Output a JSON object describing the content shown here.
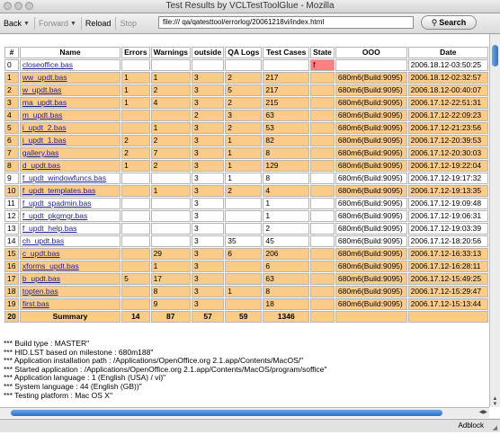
{
  "window": {
    "title": "Test Results by VCLTestToolGlue - Mozilla"
  },
  "toolbar": {
    "back_label": "Back",
    "forward_label": "Forward",
    "reload_label": "Reload",
    "stop_label": "Stop",
    "url": "file:///  qa/qatesttool/errorlog/20061218vi/index.html",
    "search_label": "Search"
  },
  "table": {
    "headers": [
      "#",
      "Name",
      "Errors",
      "Warnings",
      "outside",
      "QA Logs",
      "Test Cases",
      "State",
      "OOO",
      "Date"
    ],
    "rows": [
      {
        "n": "0",
        "name": "closeoffice.bas",
        "errors": "",
        "warnings": "",
        "outside": "",
        "qa": "",
        "tc": "",
        "state": "f",
        "ooo": "",
        "date": "2006.18.12-03:50:25",
        "hl": false,
        "red": true
      },
      {
        "n": "1",
        "name": "ww_updt.bas",
        "errors": "1",
        "warnings": "1",
        "outside": "3",
        "qa": "2",
        "tc": "217",
        "state": "",
        "ooo": "680m6(Build:9095)",
        "date": "2006.18.12-02:32:57",
        "hl": true,
        "red": false
      },
      {
        "n": "2",
        "name": "w_updt.bas",
        "errors": "1",
        "warnings": "2",
        "outside": "3",
        "qa": "5",
        "tc": "217",
        "state": "",
        "ooo": "680m6(Build:9095)",
        "date": "2006.18.12-00:40:07",
        "hl": true,
        "red": false
      },
      {
        "n": "3",
        "name": "ma_updt.bas",
        "errors": "1",
        "warnings": "4",
        "outside": "3",
        "qa": "2",
        "tc": "215",
        "state": "",
        "ooo": "680m6(Build:9095)",
        "date": "2006.17.12-22:51:31",
        "hl": true,
        "red": false
      },
      {
        "n": "4",
        "name": "m_updt.bas",
        "errors": "",
        "warnings": "",
        "outside": "2",
        "qa": "3",
        "tc": "63",
        "state": "",
        "ooo": "680m6(Build:9095)",
        "date": "2006.17.12-22:09:23",
        "hl": true,
        "red": false
      },
      {
        "n": "5",
        "name": "i_updt_2.bas",
        "errors": "",
        "warnings": "1",
        "outside": "3",
        "qa": "2",
        "tc": "53",
        "state": "",
        "ooo": "680m6(Build:9095)",
        "date": "2006.17.12-21:23:56",
        "hl": true,
        "red": false
      },
      {
        "n": "6",
        "name": "i_updt_1.bas",
        "errors": "2",
        "warnings": "2",
        "outside": "3",
        "qa": "1",
        "tc": "82",
        "state": "",
        "ooo": "680m6(Build:9095)",
        "date": "2006.17.12-20:39:53",
        "hl": true,
        "red": false
      },
      {
        "n": "7",
        "name": "gallery.bas",
        "errors": "2",
        "warnings": "7",
        "outside": "3",
        "qa": "1",
        "tc": "8",
        "state": "",
        "ooo": "680m6(Build:9095)",
        "date": "2006.17.12-20:30:03",
        "hl": true,
        "red": false
      },
      {
        "n": "8",
        "name": "d_updt.bas",
        "errors": "1",
        "warnings": "2",
        "outside": "3",
        "qa": "1",
        "tc": "129",
        "state": "",
        "ooo": "680m6(Build:9095)",
        "date": "2006.17.12-19:22:04",
        "hl": true,
        "red": false
      },
      {
        "n": "9",
        "name": "f_updt_windowfuncs.bas",
        "errors": "",
        "warnings": "",
        "outside": "3",
        "qa": "1",
        "tc": "8",
        "state": "",
        "ooo": "680m6(Build:9095)",
        "date": "2006.17.12-19:17:32",
        "hl": false,
        "red": false
      },
      {
        "n": "10",
        "name": "f_updt_templates.bas",
        "errors": "",
        "warnings": "1",
        "outside": "3",
        "qa": "2",
        "tc": "4",
        "state": "",
        "ooo": "680m6(Build:9095)",
        "date": "2006.17.12-19:13:35",
        "hl": true,
        "red": false
      },
      {
        "n": "11",
        "name": "f_updt_spadmin.bas",
        "errors": "",
        "warnings": "",
        "outside": "3",
        "qa": "",
        "tc": "1",
        "state": "",
        "ooo": "680m6(Build:9095)",
        "date": "2006.17.12-19:09:48",
        "hl": false,
        "red": false
      },
      {
        "n": "12",
        "name": "f_updt_pkgmgr.bas",
        "errors": "",
        "warnings": "",
        "outside": "3",
        "qa": "",
        "tc": "1",
        "state": "",
        "ooo": "680m6(Build:9095)",
        "date": "2006.17.12-19:06:31",
        "hl": false,
        "red": false
      },
      {
        "n": "13",
        "name": "f_updt_help.bas",
        "errors": "",
        "warnings": "",
        "outside": "3",
        "qa": "",
        "tc": "2",
        "state": "",
        "ooo": "680m6(Build:9095)",
        "date": "2006.17.12-19:03:39",
        "hl": false,
        "red": false
      },
      {
        "n": "14",
        "name": "ch_updt.bas",
        "errors": "",
        "warnings": "",
        "outside": "3",
        "qa": "35",
        "tc": "45",
        "state": "",
        "ooo": "680m6(Build:9095)",
        "date": "2006.17.12-18:20:56",
        "hl": false,
        "red": false
      },
      {
        "n": "15",
        "name": "c_updt.bas",
        "errors": "",
        "warnings": "29",
        "outside": "3",
        "qa": "6",
        "tc": "206",
        "state": "",
        "ooo": "680m6(Build:9095)",
        "date": "2006.17.12-16:33:13",
        "hl": true,
        "red": false
      },
      {
        "n": "16",
        "name": "xforms_updt.bas",
        "errors": "",
        "warnings": "1",
        "outside": "3",
        "qa": "",
        "tc": "6",
        "state": "",
        "ooo": "680m6(Build:9095)",
        "date": "2006.17.12-16:28:11",
        "hl": true,
        "red": false
      },
      {
        "n": "17",
        "name": "b_updt.bas",
        "errors": "5",
        "warnings": "17",
        "outside": "3",
        "qa": "",
        "tc": "63",
        "state": "",
        "ooo": "680m6(Build:9095)",
        "date": "2006.17.12-15:49:25",
        "hl": true,
        "red": false
      },
      {
        "n": "18",
        "name": "topten.bas",
        "errors": "",
        "warnings": "8",
        "outside": "3",
        "qa": "1",
        "tc": "8",
        "state": "",
        "ooo": "680m6(Build:9095)",
        "date": "2006.17.12-15:29:47",
        "hl": true,
        "red": false
      },
      {
        "n": "19",
        "name": "first.bas",
        "errors": "",
        "warnings": "9",
        "outside": "3",
        "qa": "",
        "tc": "18",
        "state": "",
        "ooo": "680m6(Build:9095)",
        "date": "2006.17.12-15:13:44",
        "hl": true,
        "red": false
      }
    ],
    "summary": {
      "n": "20",
      "label": "Summary",
      "errors": "14",
      "warnings": "87",
      "outside": "57",
      "qa": "59",
      "tc": "1346",
      "state": "",
      "ooo": "",
      "date": ""
    }
  },
  "log": [
    "*** Build type : MASTER\"",
    "*** HID.LST based on milestone : 680m188\"",
    "*** Application installation path : /Applications/OpenOffice.org 2.1.app/Contents/MacOS/\"",
    "*** Started application : /Applications/OpenOffice.org 2.1.app/Contents/MacOS/program/soffice\"",
    "*** Application language : 1 (English (USA) / vi)\"",
    "*** System language : 44 (English (GB))\"",
    "*** Testing platform : Mac OS X\""
  ],
  "status": {
    "adblock": "Adblock"
  },
  "colors": {
    "highlight": "#fbcb8a",
    "state_error": "#ff8080",
    "link": "#23238e"
  },
  "icons": {
    "grip": "resize-grip-icon",
    "search": "magnifier-icon"
  }
}
